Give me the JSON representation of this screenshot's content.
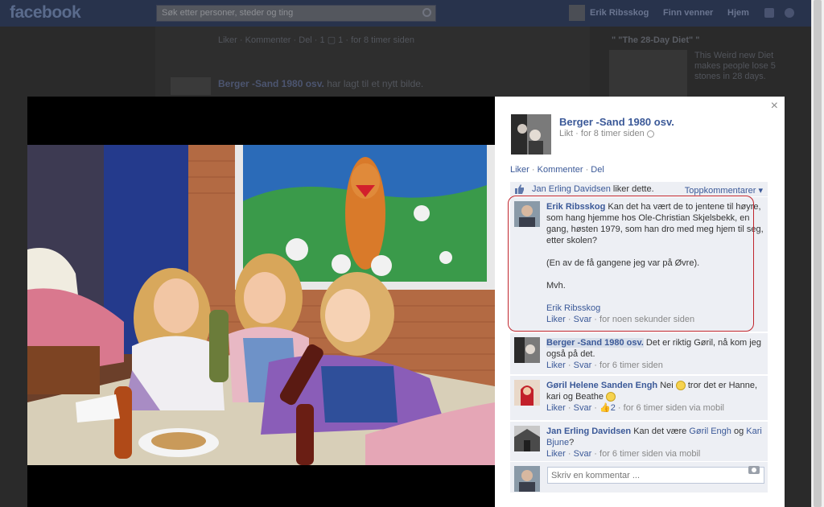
{
  "background": {
    "logo": "facebook",
    "search_placeholder": "Søk etter personer, steder og ting",
    "nav_user": "Erik Ribsskog",
    "nav_friends": "Finn venner",
    "nav_home": "Hjem",
    "post_actions": "Liker · Kommenter · Del · ",
    "post_likes": "1",
    "post_comments": "1",
    "post_time": "· for 8 timer siden",
    "album_name": "Berger -Sand 1980 osv.",
    "album_added": "har lagt til et nytt bilde.",
    "sidebar_ad_title": "\" \"The 28-Day Diet\" \"",
    "sidebar_ad_text_1": "This Weird new Diet",
    "sidebar_ad_text_2": "makes people lose 5",
    "sidebar_ad_text_3": "stones in 28 days."
  },
  "panel": {
    "close": "×",
    "album_title": "Berger -Sand 1980 osv.",
    "album_meta": "Likt · for 8 timer siden",
    "action_like": "Liker",
    "action_comment": "Kommenter",
    "action_share": "Del",
    "likes_name": "Jan Erling Davidsen",
    "likes_suffix": "liker dette.",
    "top_comments": "Toppkommentarer ▾"
  },
  "comments": [
    {
      "name": "Erik Ribsskog",
      "text": "Kan det ha vært de to jentene til høyre, som hang hjemme hos Ole-Christian Skjelsbekk, en gang, høsten 1979, som han dro med meg hjem til seg, etter skolen?",
      "text2": "(En av de få gangene jeg var på Øvre).",
      "text3": "Mvh.",
      "signature": "Erik Ribsskog",
      "like": "Liker",
      "reply": "Svar",
      "time": "for noen sekunder siden"
    },
    {
      "name": "Berger -Sand 1980 osv.",
      "text": "Det er riktig Gøril, nå kom jeg også på det.",
      "like": "Liker",
      "reply": "Svar",
      "time": "for 6 timer siden"
    },
    {
      "name": "Gøril Helene Sanden Engh",
      "text_a": "Nei",
      "text_b": "tror det er Hanne, kari og Beathe",
      "like": "Liker",
      "reply": "Svar",
      "likes": "2",
      "time": "for 6 timer siden via mobil"
    },
    {
      "name": "Jan Erling Davidsen",
      "text_a": "Kan det være",
      "tag1": "Gøril Engh",
      "text_b": "og",
      "tag2": "Kari Bjune",
      "text_c": "?",
      "like": "Liker",
      "reply": "Svar",
      "time": "for 6 timer siden via mobil"
    }
  ],
  "comment_input": {
    "placeholder": "Skriv en kommentar ..."
  },
  "colors": {
    "link": "#3b5998",
    "highlight_frame": "#c0252d",
    "comment_bg": "#edeff4"
  }
}
